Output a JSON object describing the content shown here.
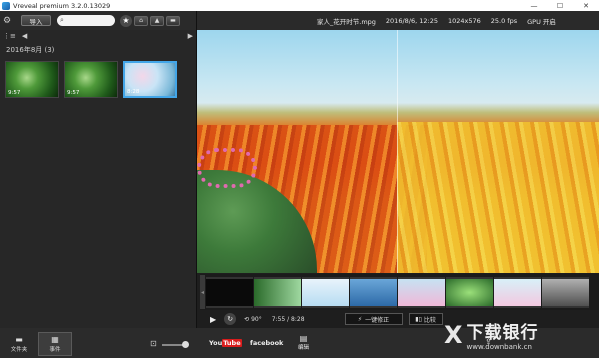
{
  "window": {
    "title": "Vreveal premium 3.2.0.13029",
    "controls": [
      "—",
      "☐",
      "✕"
    ]
  },
  "toolbar": {
    "import_label": "导入",
    "search_placeholder": "",
    "buttons": [
      "⌂",
      "▲",
      "▬"
    ]
  },
  "infobar": {
    "filename": "家人_花开时节.mpg",
    "date": "2016/8/6, 12:25",
    "resolution": "1024x576",
    "fps": "25.0 fps",
    "gpu": "GPU 开启"
  },
  "library": {
    "nav_prev": "◀",
    "nav_next": "▶",
    "group_title": "2016年8月 (3)",
    "thumbnails": [
      {
        "duration": "9:57"
      },
      {
        "duration": "9:57"
      },
      {
        "duration": "8:28"
      }
    ]
  },
  "player": {
    "play_icon": "▶",
    "loop_icon": "↻",
    "rotate_label": "90°",
    "time": "7:55 / 8:28",
    "fix_label": "一键修正",
    "compare_label": "比较"
  },
  "bottombar": {
    "folder_label": "文件夹",
    "event_label": "事件",
    "share_youtube": "You",
    "share_youtube_tube": "Tube",
    "share_facebook": "facebook",
    "share_edit": "编辑"
  },
  "watermark": {
    "logo": "X",
    "name": "下载银行",
    "url": "www.downbank.cn"
  }
}
